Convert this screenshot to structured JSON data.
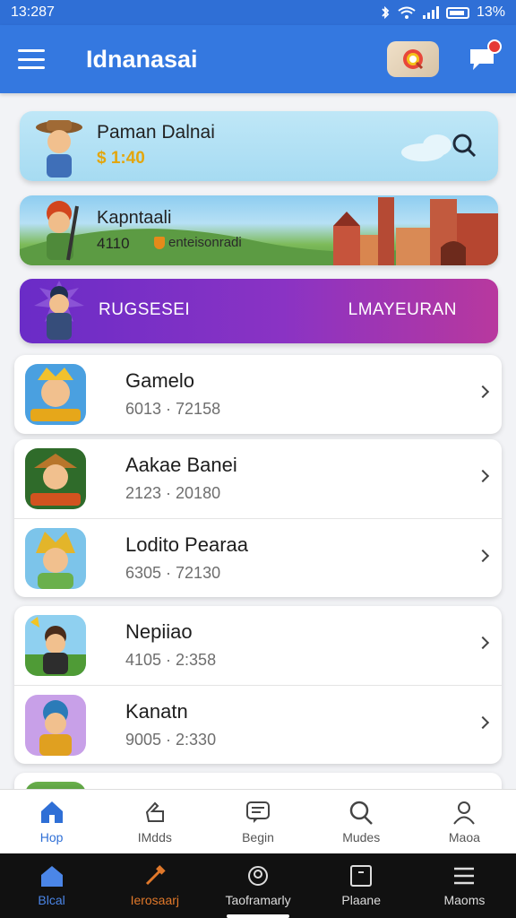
{
  "status": {
    "time": "13:287",
    "battery": "13%"
  },
  "header": {
    "title": "Idnanasai"
  },
  "banners": [
    {
      "title": "Paman Dalnai",
      "subtitle": "$ 1:40"
    },
    {
      "title": "Kapntaali",
      "subtitle": "4110",
      "tag": "enteisonradi"
    },
    {
      "left": "RUGSESEI",
      "right": "LMAYEURAN"
    }
  ],
  "list": [
    {
      "title": "Gamelo",
      "sub": "6013 · 72158"
    },
    {
      "title": "Aakae Banei",
      "sub": "2123 · 20180"
    },
    {
      "title": "Lodito Pearaa",
      "sub": "6305 · 72130"
    },
    {
      "title": "Nepiiao",
      "sub": "4105 · 2:358"
    },
    {
      "title": "Kanatn",
      "sub": "9005 · 2:330"
    }
  ],
  "bottom_nav": [
    "Hop",
    "IMdds",
    "Begin",
    "Mudes",
    "Maoa"
  ],
  "system_nav": [
    "Blcal",
    "Ierosaarj",
    "Taoframarly",
    "Plaane",
    "Maoms"
  ],
  "colors": {
    "primary": "#3478e0",
    "accent": "#e3a60d",
    "purple": "#7a2fc6"
  }
}
